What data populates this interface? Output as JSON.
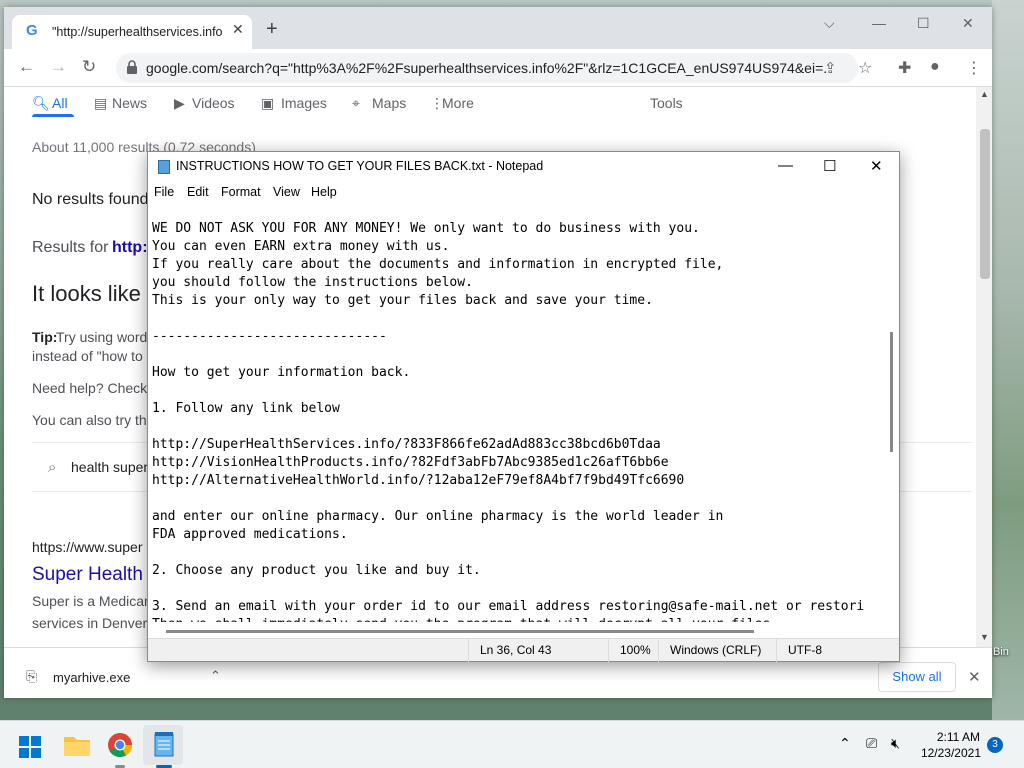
{
  "desktop": {
    "label_partial": "Bin"
  },
  "browser": {
    "tab_title": "\"http://superhealthservices.info/",
    "url": "google.com/search?q=\"http%3A%2F%2Fsuperhealthservices.info%2F\"&rlz=1C1GCEA_enUS974US974&ei=...",
    "search_tabs": [
      "All",
      "News",
      "Videos",
      "Images",
      "Maps",
      "More"
    ],
    "tools_label": "Tools",
    "results_count": "About 11,000 results (0.72 seconds)",
    "no_results": "No results found",
    "results_for_prefix": "Results for ",
    "results_for_link": "http:",
    "looks_like": "It looks like",
    "tip_label": "Tip:",
    "tip_text": " Try using word",
    "tip_line2": "instead of \"how to",
    "need_help": "Need help? Check",
    "also_try": "You can also try th",
    "suggestion": "health super",
    "result_url": "https://www.super",
    "result_title": "Super Health",
    "result_snippet_1": "Super is a Medicar",
    "result_snippet_2": "services in Denver",
    "download_file": "myarhive.exe",
    "show_all": "Show all"
  },
  "notepad": {
    "title": "INSTRUCTIONS HOW TO GET YOUR FILES BACK.txt - Notepad",
    "menu": [
      "File",
      "Edit",
      "Format",
      "View",
      "Help"
    ],
    "lines": [
      "WE DO NOT ASK YOU FOR ANY MONEY! We only want to do business with you.",
      "You can even EARN extra money with us.",
      "If you really care about the documents and information in encrypted file,",
      "you should follow the instructions below.",
      "This is your only way to get your files back and save your time.",
      "",
      "------------------------------",
      "",
      "How to get your information back.",
      "",
      "1. Follow any link below",
      "",
      "http://SuperHealthServices.info/?833F866fe62adAd883cc38bcd6b0Tdaa",
      "http://VisionHealthProducts.info/?82Fdf3abFb7Abc9385ed1c26afT6bb6e",
      "http://AlternativeHealthWorld.info/?12aba12eF79ef8A4bf7f9bd49Tfc6690",
      "",
      "and enter our online pharmacy. Our online pharmacy is the world leader in",
      "FDA approved medications.",
      "",
      "2. Choose any product you like and buy it.",
      "",
      "3. Send an email with your order id to our email address restoring@safe-mail.net or restori",
      "Then we shall immediately send you the program that will decrypt all your files"
    ],
    "status": {
      "position": "Ln 36, Col 43",
      "zoom": "100%",
      "line_ending": "Windows (CRLF)",
      "encoding": "UTF-8"
    }
  },
  "taskbar": {
    "time": "2:11 AM",
    "date": "12/23/2021",
    "notifications": "3"
  },
  "colors": {
    "chrome_accent": "#1a73e8",
    "taskbar_bg": "#f0f3f4"
  }
}
